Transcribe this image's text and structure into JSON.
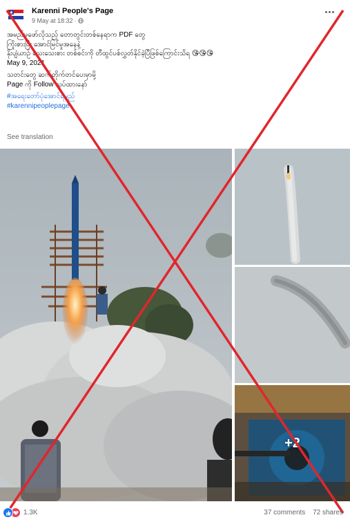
{
  "post": {
    "page_name": "Karenni People's Page",
    "timestamp": "9 May at 18:32",
    "privacy_separator": "·",
    "privacy_icon": "globe-icon",
    "more_icon": "more-options-icon",
    "caption_lines": [
      "အမည်မဖော်လိုသည့် တောတွင်းတစ်နေရာက PDF တွေ",
      "ကြိုးစားပြီး အောင်မြင်မှုအနေနဲ့",
      "နိုးပျံယာဉ် သေးသေးစား တစ်စင်းကို တီထွင်ပစ်လွှတ်နိုင်ခဲ့ပြီဖြစ်ကြောင်းသိရ 😘😘😘",
      "May 9, 2021",
      "သတင်းတွေ ဆက်တိုက်တင်ပေးမှာမို့",
      "Page ကို Follow လုပ်ထားနော်"
    ],
    "hashtags": [
      "#အရေးတော်ပုံအောင်ရမည်",
      "#karennipeoplepage"
    ],
    "see_translation": "See translation",
    "more_photos_label": "+2",
    "reaction_icons": [
      "like-icon",
      "love-icon"
    ],
    "reaction_count": "1.3K",
    "comments": "37 comments",
    "shares": "72 shares"
  },
  "colors": {
    "hashtag": "#216fdb",
    "secondary_text": "#65676b",
    "false_mark": "#e0262c",
    "like": "#1877f2",
    "love": "#f33e58"
  }
}
